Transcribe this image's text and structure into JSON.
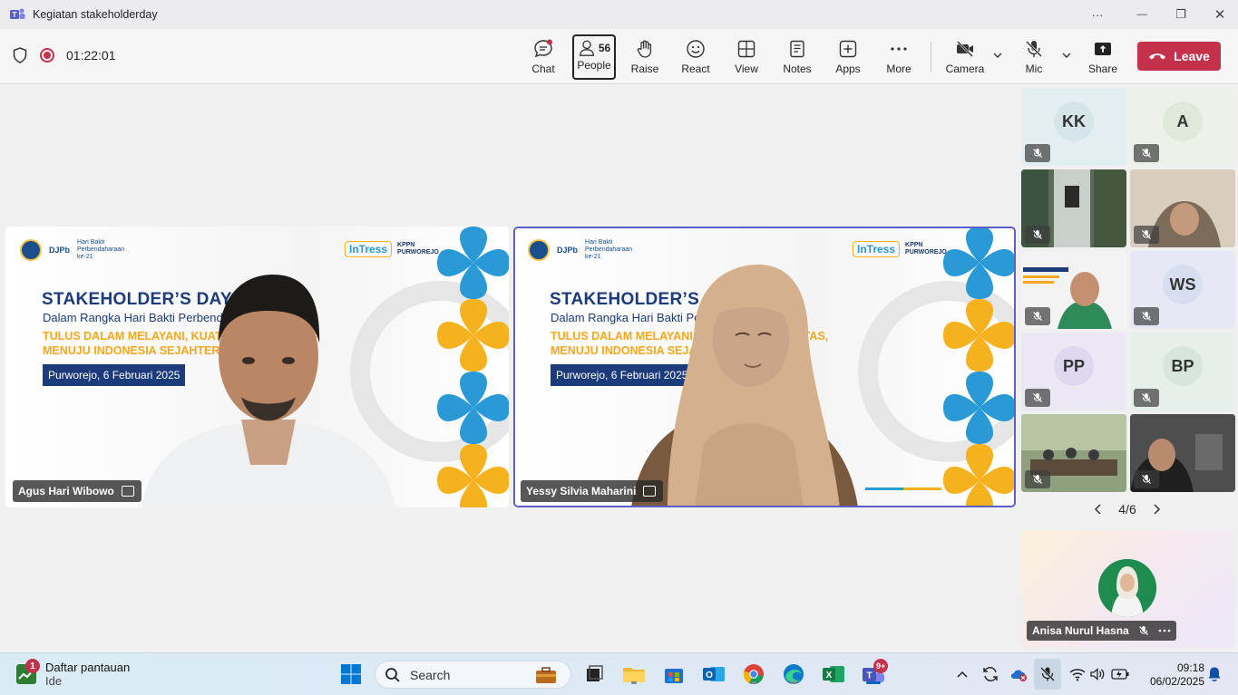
{
  "window": {
    "title": "Kegiatan stakeholderday",
    "controls": {
      "more": "···",
      "minimize": "—",
      "restore": "❐",
      "close": "✕"
    }
  },
  "meeting": {
    "timer": "01:22:01",
    "toolbar": {
      "chat": "Chat",
      "people": "People",
      "people_count": "56",
      "raise": "Raise",
      "react": "React",
      "view": "View",
      "notes": "Notes",
      "apps": "Apps",
      "more": "More",
      "camera": "Camera",
      "mic": "Mic",
      "share": "Share",
      "leave": "Leave"
    }
  },
  "slide": {
    "title": "STAKEHOLDER’S DAY",
    "subtitle": "Dalam Rangka Hari Bakti Perbendaharaan 2025",
    "tagline_1": "TULUS DALAM MELAYANI, KUATKAN INTEGRITAS,",
    "tagline_2": "MENUJU INDONESIA SEJAHTERA",
    "date": "Purworejo, 6 Februari 2025",
    "logo_djpb": "DJPb",
    "logo_hbp": "Hari Bakti Perbendaharaan ke-21",
    "logo_intress": "InTress",
    "logo_kppn_1": "KPPN",
    "logo_kppn_2": "PURWOREJO"
  },
  "videos": [
    {
      "name": "Agus Hari Wibowo"
    },
    {
      "name": "Yessy Silvia Maharini"
    }
  ],
  "gallery": {
    "tiles": [
      {
        "initials": "KK",
        "bg": "#e3eef2",
        "avatar_bg": "#d6e5ea"
      },
      {
        "initials": "A",
        "bg": "#ecf1ea",
        "avatar_bg": "#dfe8d9"
      },
      {
        "initials": "",
        "bg": "#5a6b5a"
      },
      {
        "initials": "",
        "bg": "#c9b9a6"
      },
      {
        "initials": "",
        "bg": "#e9ecef"
      },
      {
        "initials": "WS",
        "bg": "#e6e9f5",
        "avatar_bg": "#d7def0"
      },
      {
        "initials": "PP",
        "bg": "#ebe8f4",
        "avatar_bg": "#ddd8ee"
      },
      {
        "initials": "BP",
        "bg": "#e6efea",
        "avatar_bg": "#d7e6dd"
      },
      {
        "initials": "",
        "bg": "#7e8f6f"
      },
      {
        "initials": "",
        "bg": "#5c5c5c"
      }
    ],
    "pager": "4/6",
    "self_name": "Anisa Nurul Hasna"
  },
  "taskbar": {
    "widget_title": "Daftar pantauan",
    "widget_sub": "Ide",
    "widget_badge": "1",
    "search": "Search",
    "teams_badge": "9+",
    "time": "09:18",
    "date": "06/02/2025"
  },
  "colors": {
    "accent": "#5b5fc7",
    "leave": "#c4314b",
    "slide_blue": "#1b3b7a",
    "slide_gold": "#f5a81e"
  }
}
